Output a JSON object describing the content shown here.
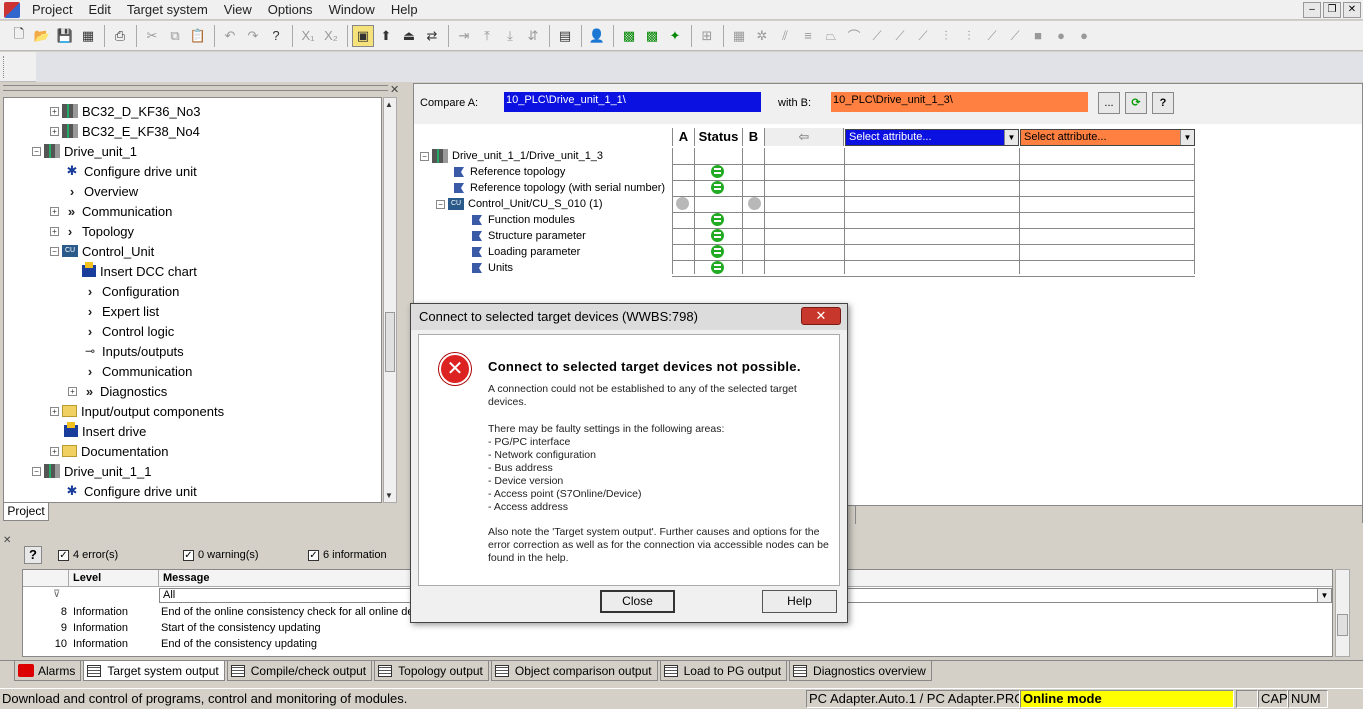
{
  "menu": [
    "Project",
    "Edit",
    "Target system",
    "View",
    "Options",
    "Window",
    "Help"
  ],
  "tree": {
    "items": [
      {
        "label": "BC32_D_KF36_No3",
        "icon": "drive",
        "indent": 46,
        "expander": "+"
      },
      {
        "label": "BC32_E_KF38_No4",
        "icon": "drive",
        "indent": 46,
        "expander": "+"
      },
      {
        "label": "Drive_unit_1",
        "icon": "drive",
        "indent": 28,
        "expander": "-"
      },
      {
        "label": "Configure drive unit",
        "icon": "gear",
        "indent": 60,
        "expander": ""
      },
      {
        "label": "Overview",
        "icon": "chev",
        "indent": 60,
        "expander": ""
      },
      {
        "label": "Communication",
        "icon": "dchev",
        "indent": 46,
        "expander": "+"
      },
      {
        "label": "Topology",
        "icon": "chev",
        "indent": 46,
        "expander": "+"
      },
      {
        "label": "Control_Unit",
        "icon": "cu",
        "indent": 46,
        "expander": "-"
      },
      {
        "label": "Insert DCC chart",
        "icon": "insert",
        "indent": 78,
        "expander": ""
      },
      {
        "label": "Configuration",
        "icon": "chev",
        "indent": 78,
        "expander": ""
      },
      {
        "label": "Expert list",
        "icon": "chev",
        "indent": 78,
        "expander": ""
      },
      {
        "label": "Control logic",
        "icon": "chev",
        "indent": 78,
        "expander": ""
      },
      {
        "label": "Inputs/outputs",
        "icon": "io",
        "indent": 78,
        "expander": ""
      },
      {
        "label": "Communication",
        "icon": "chev",
        "indent": 78,
        "expander": ""
      },
      {
        "label": "Diagnostics",
        "icon": "dchev",
        "indent": 64,
        "expander": "+"
      },
      {
        "label": "Input/output components",
        "icon": "folder",
        "indent": 46,
        "expander": "+"
      },
      {
        "label": "Insert drive",
        "icon": "insert",
        "indent": 60,
        "expander": ""
      },
      {
        "label": "Documentation",
        "icon": "folder",
        "indent": 46,
        "expander": "+"
      },
      {
        "label": "Drive_unit_1_1",
        "icon": "drive",
        "indent": 28,
        "expander": "-"
      },
      {
        "label": "Configure drive unit",
        "icon": "gear",
        "indent": 60,
        "expander": ""
      }
    ],
    "tab_label": "Project"
  },
  "compare": {
    "label_a": "Compare A:",
    "value_a": "10_PLC\\Drive_unit_1_1\\",
    "label_b": "with B:",
    "value_b": "10_PLC\\Drive_unit_1_3\\",
    "browse": "...",
    "refresh": "⟳",
    "help": "?",
    "col_a": "A",
    "col_status": "Status",
    "col_b": "B",
    "select_attr_a": "Select attribute...",
    "select_attr_b": "Select attribute...",
    "color_a": "#0b11e0",
    "color_b": "#ff8040",
    "rows": [
      {
        "label": "Drive_unit_1_1/Drive_unit_1_3",
        "type": "root",
        "status": "none"
      },
      {
        "label": "Reference topology",
        "type": "leaf1",
        "status": "ok"
      },
      {
        "label": "Reference topology (with serial number)",
        "type": "leaf1",
        "status": "ok"
      },
      {
        "label": "Control_Unit/CU_S_010 (1)",
        "type": "cu",
        "status": "gray"
      },
      {
        "label": "Function modules",
        "type": "leaf2",
        "status": "ok"
      },
      {
        "label": "Structure parameter",
        "type": "leaf2",
        "status": "ok"
      },
      {
        "label": "Loading parameter",
        "type": "leaf2",
        "status": "ok"
      },
      {
        "label": "Units",
        "type": "leaf2",
        "status": "ok"
      }
    ]
  },
  "output": {
    "errors": "4 error(s)",
    "warnings": "0 warning(s)",
    "infos": "6 information",
    "col_level": "Level",
    "col_message": "Message",
    "filter_value": "All",
    "rows": [
      {
        "num": "8",
        "level": "Information",
        "message": "End of the online consistency check for all online de"
      },
      {
        "num": "9",
        "level": "Information",
        "message": "Start of the consistency updating"
      },
      {
        "num": "10",
        "level": "Information",
        "message": "End of the consistency updating"
      }
    ]
  },
  "bottom_tabs": [
    {
      "label": "Alarms",
      "icon": "alarm",
      "active": false
    },
    {
      "label": "Target system output",
      "icon": "grid",
      "active": true
    },
    {
      "label": "Compile/check output",
      "icon": "grid",
      "active": false
    },
    {
      "label": "Topology output",
      "icon": "grid",
      "active": false
    },
    {
      "label": "Object comparison output",
      "icon": "grid",
      "active": false
    },
    {
      "label": "Load to PG output",
      "icon": "grid",
      "active": false
    },
    {
      "label": "Diagnostics overview",
      "icon": "diag",
      "active": false
    }
  ],
  "status": {
    "text": "Download and control of programs, control and monitoring of modules.",
    "adapter": "PC Adapter.Auto.1 / PC Adapter.PRC",
    "mode": "Online mode",
    "cap": "CAP",
    "num": "NUM"
  },
  "dialog": {
    "title": "Connect to selected target devices (WWBS:798)",
    "heading": "Connect to selected target devices not possible.",
    "p1": "A connection could not be established to any of the selected target devices.",
    "p2": "There may be faulty settings in the following areas:\n- PG/PC interface\n- Network configuration\n- Bus address\n- Device version\n- Access point (S7Online/Device)\n- Access address",
    "p3": "Also note the 'Target system output'. Further causes and options for the error correction as well as for the connection via accessible nodes can be found in the help.",
    "close": "Close",
    "help": "Help"
  }
}
